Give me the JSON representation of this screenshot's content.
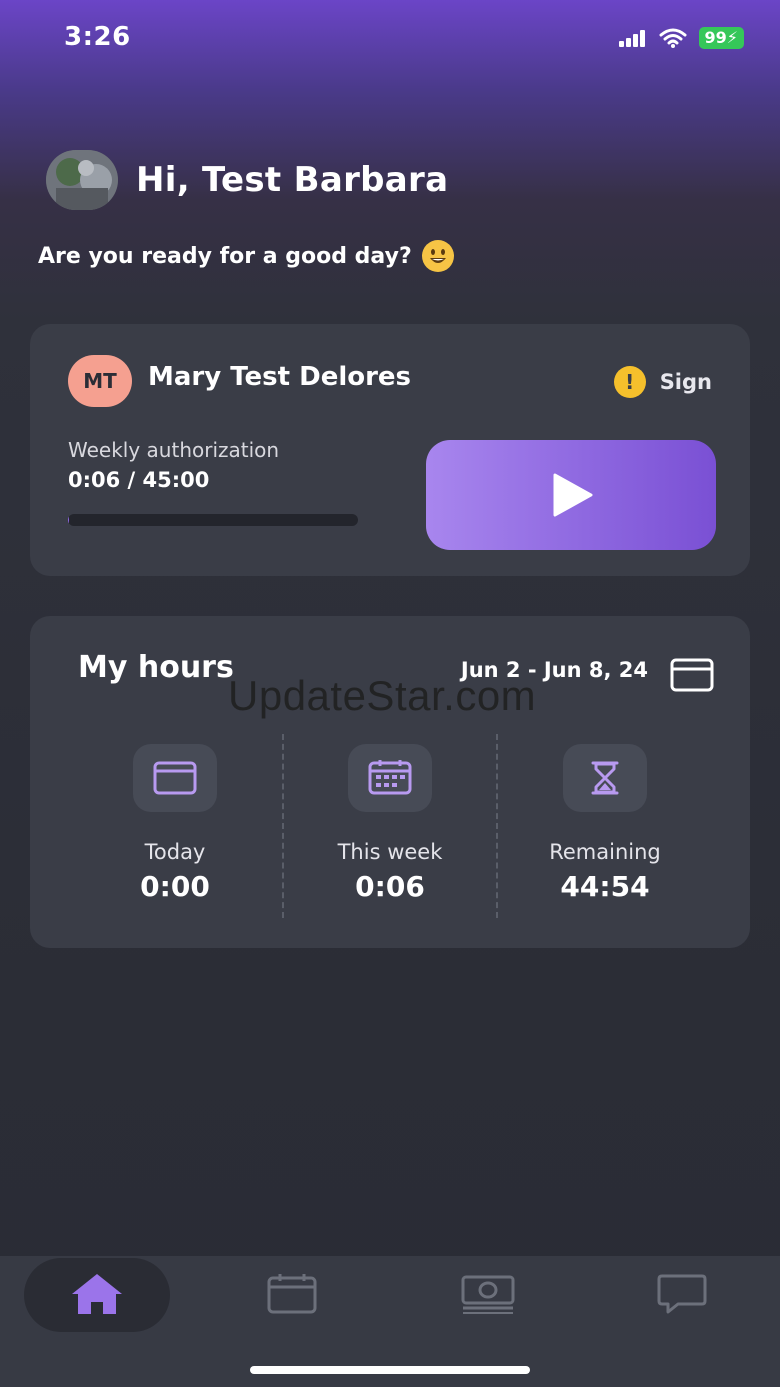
{
  "status_bar": {
    "time": "3:26",
    "battery": "99"
  },
  "header": {
    "greeting": "Hi, Test Barbara",
    "subtitle": "Are you ready for a good day?"
  },
  "client_card": {
    "initials": "MT",
    "name": "Mary Test Delores",
    "warning_icon": "!",
    "sign_label": "Sign",
    "authorization_label": "Weekly authorization",
    "authorization_value": "0:06 / 45:00",
    "progress_fraction": 0.002
  },
  "hours": {
    "title": "My hours",
    "date_range": "Jun 2 - Jun 8, 24",
    "stats": [
      {
        "label": "Today",
        "value": "0:00",
        "icon": "calendar-icon"
      },
      {
        "label": "This week",
        "value": "0:06",
        "icon": "calendar-week-icon"
      },
      {
        "label": "Remaining",
        "value": "44:54",
        "icon": "hourglass-icon"
      }
    ]
  },
  "watermark": "UpdateStar.com",
  "tabs": [
    {
      "name": "home",
      "icon": "home-icon",
      "active": true
    },
    {
      "name": "calendar",
      "icon": "calendar-icon",
      "active": false
    },
    {
      "name": "payments",
      "icon": "money-icon",
      "active": false
    },
    {
      "name": "messages",
      "icon": "chat-icon",
      "active": false
    }
  ],
  "colors": {
    "accent": "#8c65e0",
    "card": "#3a3d47",
    "warning": "#f5c02c",
    "avatar_badge": "#f5a090"
  }
}
